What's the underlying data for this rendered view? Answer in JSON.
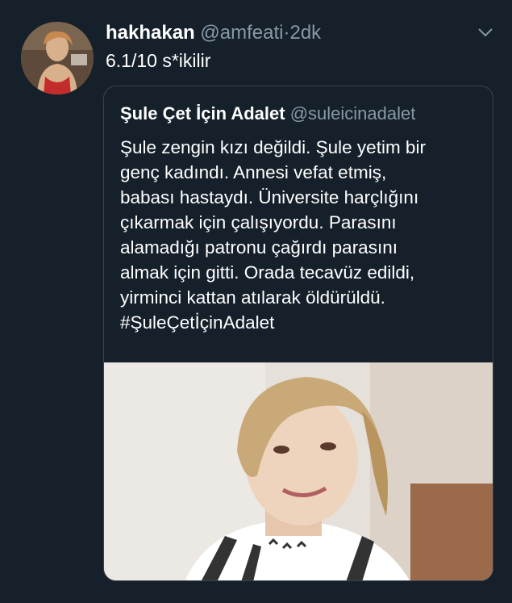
{
  "tweet": {
    "display_name": "hakhakan",
    "handle": "@amfeati",
    "separator": "·",
    "time": "2dk",
    "text": "6.1/10 s*ikilir",
    "menu_icon": "chevron-down-icon",
    "avatar_icon": "profile-photo"
  },
  "quote": {
    "display_name": "Şule Çet İçin Adalet",
    "handle": "@suleicinadalet",
    "lines": [
      "Şule zengin kızı değildi. Şule yetim bir",
      "genç kadındı. Annesi vefat etmiş,",
      "babası hastaydı. Üniversite harçlığını",
      "çıkarmak için çalışıyordu. Parasını",
      "alamadığı patronu çağırdı parasını",
      "almak için gitti. Orada tecavüz edildi,",
      "yirminci kattan atılarak öldürüldü.",
      "#ŞuleÇetİçinAdalet"
    ],
    "image_icon": "portrait-photo"
  },
  "colors": {
    "background": "#15202b",
    "border": "#38444d",
    "secondary_text": "#8899a6"
  }
}
